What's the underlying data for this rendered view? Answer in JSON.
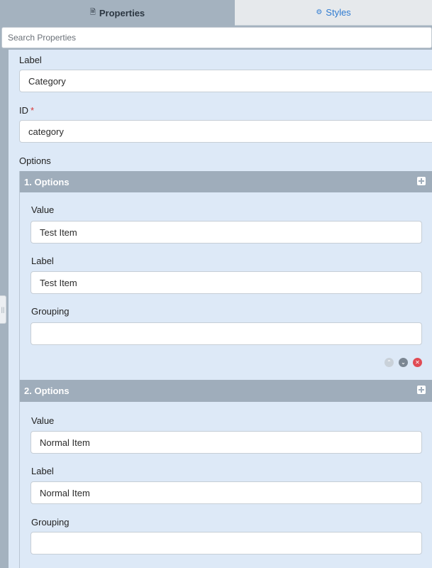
{
  "tabs": {
    "properties": {
      "label": "Properties",
      "glyph": "🗎"
    },
    "styles": {
      "label": "Styles",
      "glyph": "⚙"
    }
  },
  "search": {
    "placeholder": "Search Properties",
    "value": ""
  },
  "form": {
    "label_field": {
      "label": "Label",
      "value": "Category"
    },
    "id_field": {
      "label": "ID",
      "required_mark": "*",
      "value": "category"
    },
    "options_label": "Options",
    "options": [
      {
        "title": "1. Options",
        "value_label": "Value",
        "value": "Test Item",
        "label_label": "Label",
        "label": "Test Item",
        "grouping_label": "Grouping",
        "grouping": ""
      },
      {
        "title": "2. Options",
        "value_label": "Value",
        "value": "Normal Item",
        "label_label": "Label",
        "label": "Normal Item",
        "grouping_label": "Grouping",
        "grouping": ""
      }
    ]
  },
  "icons": {
    "properties_tab": "document-icon",
    "styles_tab": "gear-icon",
    "add": "plus-square-icon",
    "move_up": "chevron-up-circle-icon",
    "move_down": "chevron-down-circle-icon",
    "remove": "close-circle-icon",
    "resize": "grip-icon"
  },
  "colors": {
    "panel_bg": "#dde9f7",
    "header_bg": "#9fadbb",
    "sidebar_bg": "#a4b2bf",
    "accent_blue": "#2f7bd1",
    "danger": "#e04b54",
    "required": "#d93636"
  }
}
